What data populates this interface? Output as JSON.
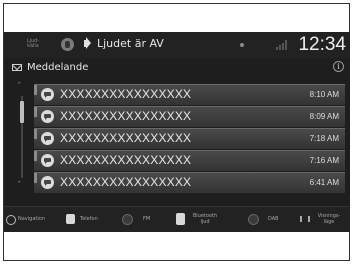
{
  "status_bar": {
    "left_label": "Ljud-källa",
    "audio_status": "Ljudet är AV",
    "clock": "12:34"
  },
  "header": {
    "title": "Meddelande",
    "info_glyph": "i"
  },
  "messages": [
    {
      "text": "XXXXXXXXXXXXXXXX",
      "time": "8:10 AM"
    },
    {
      "text": "XXXXXXXXXXXXXXXX",
      "time": "8:09 AM"
    },
    {
      "text": "XXXXXXXXXXXXXXXX",
      "time": "7:18 AM"
    },
    {
      "text": "XXXXXXXXXXXXXXXX",
      "time": "7:16 AM"
    },
    {
      "text": "XXXXXXXXXXXXXXXX",
      "time": "6:41 AM"
    }
  ],
  "bottom_nav": [
    {
      "label": "Navigation",
      "icon": "navigation-icon"
    },
    {
      "label": "Telefon",
      "icon": "phone-icon"
    },
    {
      "label": "FM",
      "icon": "radio-icon"
    },
    {
      "label": "Bluetooth ljud",
      "icon": "bluetooth-icon"
    },
    {
      "label": "DAB",
      "icon": "radio-icon"
    },
    {
      "label": "Visnings-läge",
      "icon": "display-mode-icon"
    }
  ],
  "icons": {
    "mail": "mail-icon",
    "message": "message-bubble-icon",
    "speaker": "speaker-icon",
    "scroll_up": "double-chevron-up-icon",
    "scroll_down": "double-chevron-down-icon",
    "info": "info-icon"
  }
}
